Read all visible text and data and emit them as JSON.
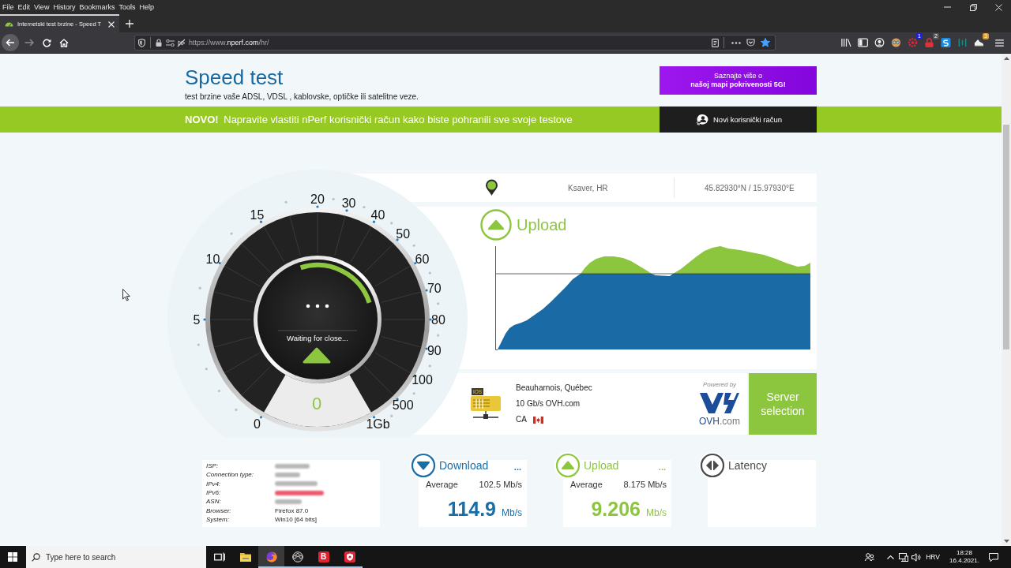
{
  "menu_bar": {
    "items": [
      "File",
      "Edit",
      "View",
      "History",
      "Bookmarks",
      "Tools",
      "Help"
    ]
  },
  "tabs": [
    {
      "title": "Internetski test brzine - Speed T",
      "selected": true
    }
  ],
  "address_bar": {
    "url_start": "https://www.",
    "url_domain": "nperf.com",
    "url_end": "/hr/",
    "bookmarked": true
  },
  "extension_badges": [
    {
      "text": "1",
      "color": "#1f1fd6"
    },
    {
      "text": "2",
      "color": "#555555"
    },
    {
      "text": "3",
      "color": "#d99a2b"
    }
  ],
  "header": {
    "title": "Speed test",
    "subtitle": "test brzine vaše ADSL, VDSL , kablovske, optičke ili satelitne veze.",
    "promo_button": {
      "line_1": "Saznajte više o",
      "line_2": "našoj mapi pokrivenosti 5G!"
    }
  },
  "banner": {
    "message": "**NOVO!** Napravite vlastiti nPerf korisnički račun kako biste pohranili sve svoje testove",
    "button": "Novi korisnički račun"
  },
  "speedometer": {
    "scale": [
      "0",
      "5",
      "10",
      "15",
      "20",
      "30",
      "40",
      "50",
      "60",
      "70",
      "80",
      "90",
      "100",
      "500",
      "1Gb"
    ],
    "status": "Waiting for close...",
    "value": "0"
  },
  "location": {
    "place": "Ksaver, HR",
    "coordinates": "45.82930°N / 15.97930°E"
  },
  "graph": {
    "title": "Upload"
  },
  "server": {
    "icon_label": "IOS",
    "city": "Beauharnois, Québec",
    "host": "10 Gb/s OVH.com",
    "country": "CA",
    "powered_by": "Powered by",
    "logo_name": "OVH",
    "logo_domain": ".com",
    "button": "Server selection"
  },
  "connection_info": [
    {
      "label": "ISP:",
      "redacted": true,
      "alert": false
    },
    {
      "label": "Connection type:",
      "redacted": true,
      "alert": false
    },
    {
      "label": "IPv4:",
      "redacted": true,
      "alert": false
    },
    {
      "label": "IPv6:",
      "redacted": true,
      "alert": true
    },
    {
      "label": "ASN:",
      "redacted": true,
      "alert": false
    },
    {
      "label": "Browser:",
      "redacted": false,
      "alert": false,
      "value": "Firefox 87.0"
    },
    {
      "label": "System:",
      "redacted": false,
      "alert": false,
      "value": "Win10 [64 bits]"
    }
  ],
  "results": [
    {
      "kind": "download",
      "title": "Download",
      "menu": "...",
      "average_label": "Average",
      "average": "102.5 Mb/s",
      "value": "114.9",
      "unit": "Mb/s"
    },
    {
      "kind": "upload",
      "title": "Upload",
      "menu": "...",
      "average_label": "Average",
      "average": "8.175 Mb/s",
      "value": "9.206",
      "unit": "Mb/s"
    },
    {
      "kind": "latency",
      "title": "Latency"
    }
  ],
  "taskbar": {
    "search_placeholder": "Type here to search",
    "apps": [
      {
        "kind": "task-view",
        "selected": false,
        "running": false
      },
      {
        "kind": "folder",
        "selected": false,
        "running": false
      },
      {
        "kind": "browser",
        "selected": true,
        "running": true
      },
      {
        "kind": "aperture",
        "selected": false,
        "running": true
      },
      {
        "kind": "letter",
        "label": "B",
        "selected": false,
        "running": true
      },
      {
        "kind": "shield",
        "selected": false,
        "running": true
      }
    ],
    "language": "HRV",
    "time": "18:28",
    "date": "16.4.2021."
  }
}
